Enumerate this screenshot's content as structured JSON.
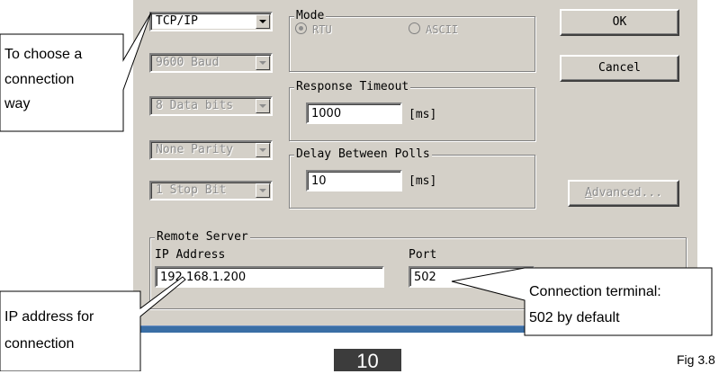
{
  "connection": {
    "type_value": "TCP/IP",
    "baud_value": "9600 Baud",
    "data_bits_value": "8 Data bits",
    "parity_value": "None Parity",
    "stop_bits_value": "1 Stop Bit"
  },
  "mode": {
    "legend": "Mode",
    "options": [
      {
        "label": "RTU",
        "selected": true
      },
      {
        "label": "ASCII",
        "selected": false
      }
    ]
  },
  "response_timeout": {
    "legend": "Response Timeout",
    "value": "1000",
    "unit": "[ms]"
  },
  "delay_between_polls": {
    "legend": "Delay Between Polls",
    "value": "10",
    "unit": "[ms]"
  },
  "buttons": {
    "ok": "OK",
    "cancel": "Cancel",
    "advanced": "Advanced..."
  },
  "remote_server": {
    "legend": "Remote Server",
    "ip_label": "IP Address",
    "ip_value": "192.168.1.200",
    "port_label": "Port",
    "port_value": "502"
  },
  "callouts": {
    "connection_way": [
      "To  choose a",
      "connection",
      "way"
    ],
    "ip_address": [
      "IP address for",
      "connection"
    ],
    "port": [
      "Connection terminal:",
      "502 by default"
    ]
  },
  "page_number": "10",
  "figure_label": "Fig 3.8",
  "colors": {
    "dialog_bg": "#d4d0c8",
    "strip": "#3a6ea5",
    "page_box": "#3c3c3c"
  }
}
